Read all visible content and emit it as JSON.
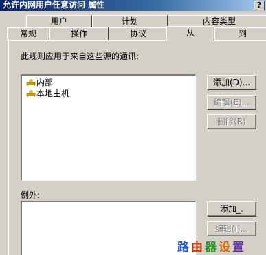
{
  "window": {
    "title": "允许内网用户任意访问 属性",
    "help_label": "?"
  },
  "tabs": {
    "row1": [
      {
        "label": "用户"
      },
      {
        "label": "计划"
      },
      {
        "label": "内容类型"
      }
    ],
    "row2": [
      {
        "label": "常规"
      },
      {
        "label": "操作"
      },
      {
        "label": "协议"
      },
      {
        "label": "从",
        "active": true
      },
      {
        "label": "到"
      }
    ]
  },
  "from_section": {
    "description": "此规则应用于来自这些源的通讯:",
    "items": [
      {
        "label": "内部",
        "icon": "network-icon"
      },
      {
        "label": "本地主机",
        "icon": "network-icon"
      }
    ],
    "buttons": {
      "add": "添加(D)...",
      "edit": "编辑(E)...",
      "remove": "删除(R)"
    }
  },
  "exceptions_section": {
    "label": "例外:",
    "buttons": {
      "add": "添加_.",
      "edit": "编辑(I)..."
    }
  },
  "watermark": {
    "chars": [
      "路",
      "由",
      "器",
      "设",
      "置"
    ],
    "colors": [
      "#2255cc",
      "#cc3300",
      "#229922",
      "#cc6600",
      "#6633aa"
    ]
  }
}
